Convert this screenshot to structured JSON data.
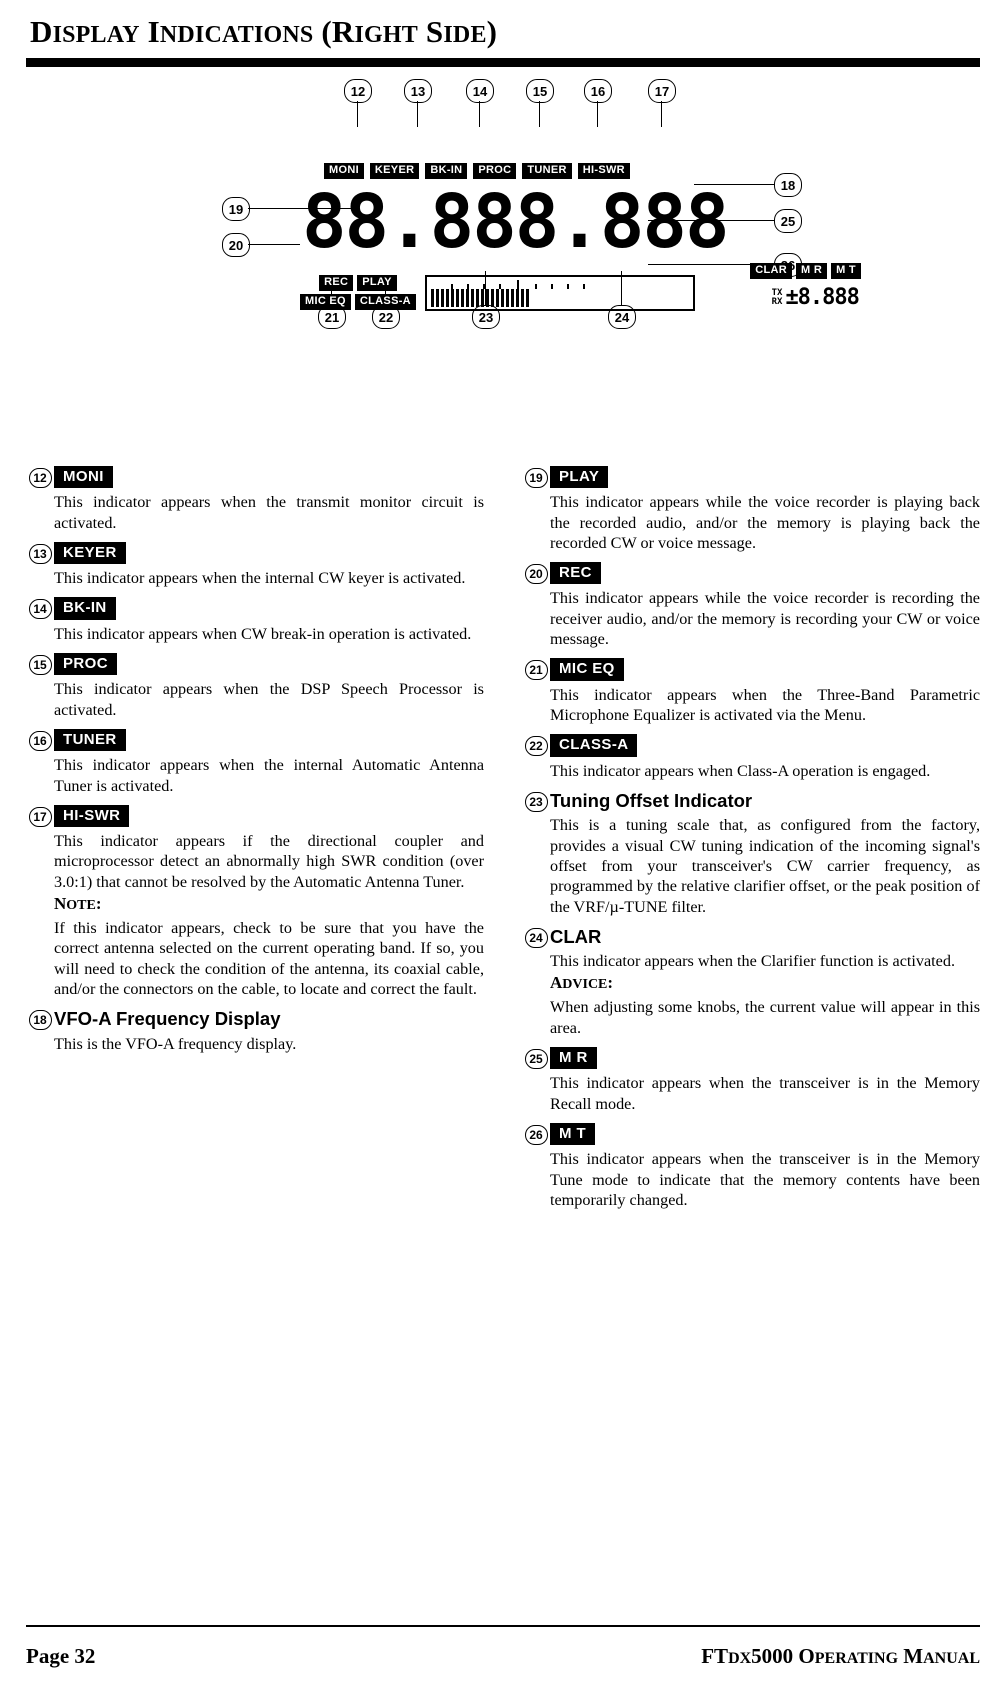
{
  "header": {
    "title_main": "D",
    "title": "DISPLAY INDICATIONS (RIGHT SIDE)",
    "parts": [
      "D",
      "ISPLAY",
      " I",
      "NDICATIONS",
      " (",
      "R",
      "IGHT",
      " S",
      "IDE",
      ")"
    ]
  },
  "diagram": {
    "callouts_top": [
      "12",
      "13",
      "14",
      "15",
      "16",
      "17"
    ],
    "callouts_left": [
      "19",
      "20"
    ],
    "callouts_right": [
      "18",
      "25",
      "26"
    ],
    "callouts_bottom": [
      "21",
      "22",
      "23",
      "24"
    ],
    "top_tags": [
      "MONI",
      "KEYER",
      "BK-IN",
      "PROC",
      "TUNER",
      "HI-SWR"
    ],
    "main_digits": "88.888.888",
    "sub_tags_row1": [
      "REC",
      "PLAY"
    ],
    "sub_tags_row2": [
      "MIC EQ",
      "CLASS-A"
    ],
    "clar_tag": "CLAR",
    "mr_tag": "M R",
    "mt_tag": "M T",
    "tx_label": "TX",
    "rx_label": "RX",
    "clar_value": "±8.888"
  },
  "left_column": [
    {
      "num": "12",
      "tag": "MONI",
      "text": "This indicator appears when the transmit monitor circuit is activated."
    },
    {
      "num": "13",
      "tag": "KEYER",
      "text": "This indicator appears when the internal CW keyer is activated."
    },
    {
      "num": "14",
      "tag": "BK-IN",
      "text": "This indicator appears when CW break-in operation is activated."
    },
    {
      "num": "15",
      "tag": "PROC",
      "text": "This indicator appears when the DSP Speech Processor is activated."
    },
    {
      "num": "16",
      "tag": "TUNER",
      "text": "This indicator appears when the internal Automatic Antenna Tuner is activated."
    },
    {
      "num": "17",
      "tag": "HI-SWR",
      "text": "This indicator appears if the directional coupler and microprocessor detect an abnormally high SWR condition (over 3.0:1) that cannot be resolved by the Automatic Antenna Tuner.",
      "note_label": "NOTE:",
      "note_text": "If this indicator appears, check to be sure that you have the correct antenna selected on the current operating band. If so, you will need to check the condition of the antenna, its coaxial cable, and/or the connectors on the cable, to locate and correct the fault."
    },
    {
      "num": "18",
      "heading": "VFO-A Frequency Display",
      "text": "This is the VFO-A frequency display."
    }
  ],
  "right_column": [
    {
      "num": "19",
      "tag": "PLAY",
      "text": "This indicator appears while the voice recorder is playing back the recorded audio, and/or the memory is playing back the recorded CW or voice message."
    },
    {
      "num": "20",
      "tag": "REC",
      "text": "This indicator appears while the voice recorder is recording the receiver audio, and/or the memory is recording your CW or voice message."
    },
    {
      "num": "21",
      "tag": "MIC EQ",
      "text": "This indicator appears when the Three-Band Parametric Microphone Equalizer is activated via the Menu."
    },
    {
      "num": "22",
      "tag": "CLASS-A",
      "text": "This indicator appears when Class-A operation is engaged."
    },
    {
      "num": "23",
      "heading": "Tuning Offset Indicator",
      "text": "This is a tuning scale that, as configured from the factory, provides a visual CW tuning indication of the incoming signal's offset from your transceiver's CW carrier frequency, as programmed by the relative clarifier offset, or the peak position of the VRF/µ-TUNE filter."
    },
    {
      "num": "24",
      "heading": "CLAR",
      "text": "This indicator appears when the Clarifier function is activated.",
      "note_label": "ADVICE:",
      "note_text": "When adjusting some knobs, the current value will appear in this area."
    },
    {
      "num": "25",
      "tag": "M R",
      "text": "This indicator appears when the transceiver is in the Memory Recall mode."
    },
    {
      "num": "26",
      "tag": "M T",
      "text": "This indicator appears when the transceiver is in the Memory Tune mode to indicate that the memory contents have been temporarily changed."
    }
  ],
  "footer": {
    "left": "Page 32",
    "right": "FTDX5000 OPERATING MANUAL"
  }
}
